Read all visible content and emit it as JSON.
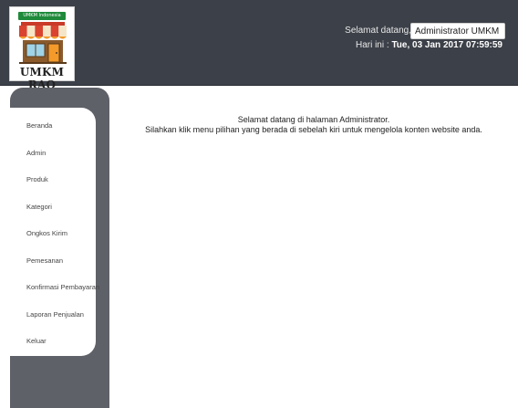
{
  "header": {
    "logo": {
      "banner_text": "UMKM Indonesia",
      "name": "UMKM RAO"
    },
    "welcome_label": "Selamat datang,",
    "admin_name": "Administrator UMKM RAO",
    "today_label": "Hari ini :",
    "today_value": "Tue, 03 Jan 2017 07:59:59"
  },
  "sidebar": {
    "items": [
      {
        "label": "Beranda"
      },
      {
        "label": "Admin"
      },
      {
        "label": "Produk"
      },
      {
        "label": "Kategori"
      },
      {
        "label": "Ongkos Kirim"
      },
      {
        "label": "Pemesanan"
      },
      {
        "label": "Konfirmasi Pembayaran"
      },
      {
        "label": "Laporan Penjualan"
      },
      {
        "label": "Keluar"
      }
    ]
  },
  "main": {
    "welcome_line": "Selamat datang di halaman Administrator.",
    "instruction_line": "Silahkan klik menu pilihan yang berada di sebelah kiri untuk mengelola konten website anda."
  },
  "colors": {
    "header_bg": "#3c4048",
    "sidebar_bg": "#5f6168",
    "logo_green": "#1f8a3a",
    "awning_red": "#d9432f",
    "awning_orange": "#f39a2b"
  }
}
